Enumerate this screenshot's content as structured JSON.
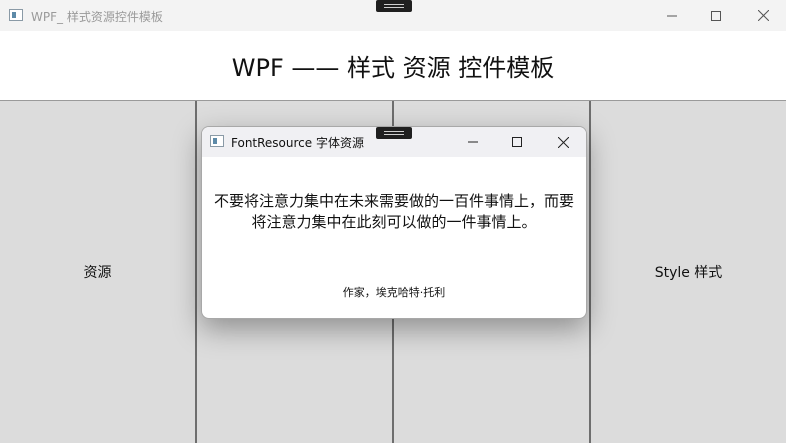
{
  "main_window": {
    "title": "WPF_ 样式资源控件模板",
    "header_title": "WPF —— 样式 资源 控件模板",
    "panels": [
      "资源",
      "",
      "",
      "Style 样式"
    ]
  },
  "dialog": {
    "title": "FontResource 字体资源",
    "quote_line1": "不要将注意力集中在未来需要做的一百件事情上，而要",
    "quote_line2": "将注意力集中在此刻可以做的一件事情上。",
    "author": "作家，埃克哈特·托利"
  },
  "icons": {
    "minimize": "minimize-icon",
    "maximize": "maximize-icon",
    "close": "close-icon"
  }
}
